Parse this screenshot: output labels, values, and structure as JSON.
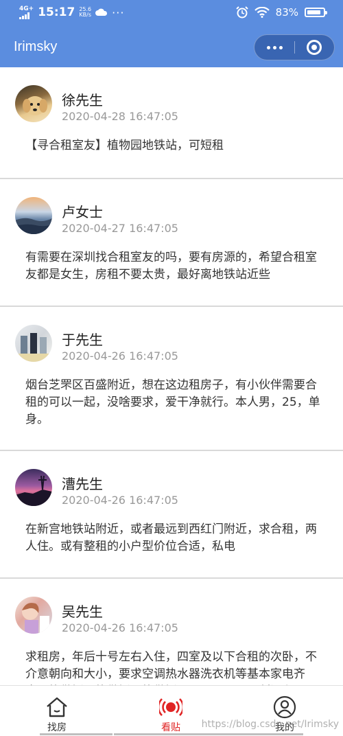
{
  "status_bar": {
    "network": "4G+",
    "time": "15:17",
    "speed_value": "25.6",
    "speed_unit": "KB/s",
    "battery": "83%"
  },
  "navbar": {
    "title": "Irimsky"
  },
  "posts": [
    {
      "name": "徐先生",
      "time": "2020-04-28 16:47:05",
      "content": "【寻合租室友】植物园地铁站，可短租"
    },
    {
      "name": "卢女士",
      "time": "2020-04-27 16:47:05",
      "content": "有需要在深圳找合租室友的吗，要有房源的，希望合租室友都是女生，房租不要太贵，最好离地铁站近些"
    },
    {
      "name": "于先生",
      "time": "2020-04-26 16:47:05",
      "content": "烟台芝罘区百盛附近，想在这边租房子，有小伙伴需要合租的可以一起，没啥要求，爱干净就行。本人男，25，单身。"
    },
    {
      "name": "漕先生",
      "time": "2020-04-26 16:47:05",
      "content": "在新宫地铁站附近，或者最远到西红门附近，求合租，两人住。或有整租的小户型价位合适，私电"
    },
    {
      "name": "吴先生",
      "time": "2020-04-26 16:47:05",
      "content": "求租房，年后十号左右入住，四室及以下合租的次卧，不介意朝向和大小，要求空调热水器洗衣机等基本家电齐全，能做饭，能做饭，能做饭！！！！不要隔断间和"
    }
  ],
  "tabbar": {
    "tabs": [
      {
        "label": "找房",
        "icon": "home-icon"
      },
      {
        "label": "看贴",
        "icon": "broadcast-icon"
      },
      {
        "label": "我的",
        "icon": "user-icon"
      }
    ],
    "watermark": "https://blog.csdn.net/Irimsky"
  },
  "colors": {
    "header": "#5b8ddf",
    "active": "#e02424"
  }
}
